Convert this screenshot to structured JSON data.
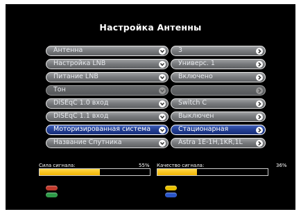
{
  "title": "Настройка Антенны",
  "rows": [
    {
      "label": "Антенна",
      "value": "3",
      "state": "normal"
    },
    {
      "label": "Настройка LNB",
      "value": "Универс. 1",
      "state": "normal"
    },
    {
      "label": "Питание LNB",
      "value": "Включено",
      "state": "normal"
    },
    {
      "label": "Тон",
      "value": "",
      "state": "disabled"
    },
    {
      "label": "DiSEqC 1.0 вход",
      "value": "Switch C",
      "state": "normal"
    },
    {
      "label": "DiSEqC 1.1 вход",
      "value": "Выключен",
      "state": "normal"
    },
    {
      "label": "Моторизированная система",
      "value": "Стационарная",
      "state": "active"
    },
    {
      "label": "Название Спутника",
      "value": "Astra 1E-1H,1KR,1L",
      "state": "normal"
    }
  ],
  "signal_strength": {
    "label": "Сила сигнала:",
    "percent_text": "55%",
    "level": 0.55
  },
  "signal_quality": {
    "label": "Качество сигнала:",
    "percent_text": "36%",
    "level": 0.36
  },
  "colors": {
    "background": "#000000",
    "active_row": "#233e92",
    "bar_fill": "#f5c000",
    "btn_red": "#c0392b",
    "btn_green": "#2e9a48",
    "btn_yellow": "#e8c000",
    "btn_blue": "#2a55c8"
  },
  "color_buttons": [
    {
      "name": "red-button",
      "color": "#c0392b"
    },
    {
      "name": "green-button",
      "color": "#2e9a48"
    },
    {
      "name": "yellow-button",
      "color": "#e8c000"
    },
    {
      "name": "blue-button",
      "color": "#2a55c8"
    }
  ],
  "icons": {
    "row_arrow": "chevron-right-icon",
    "field_dropdown": "chevron-down-icon"
  }
}
